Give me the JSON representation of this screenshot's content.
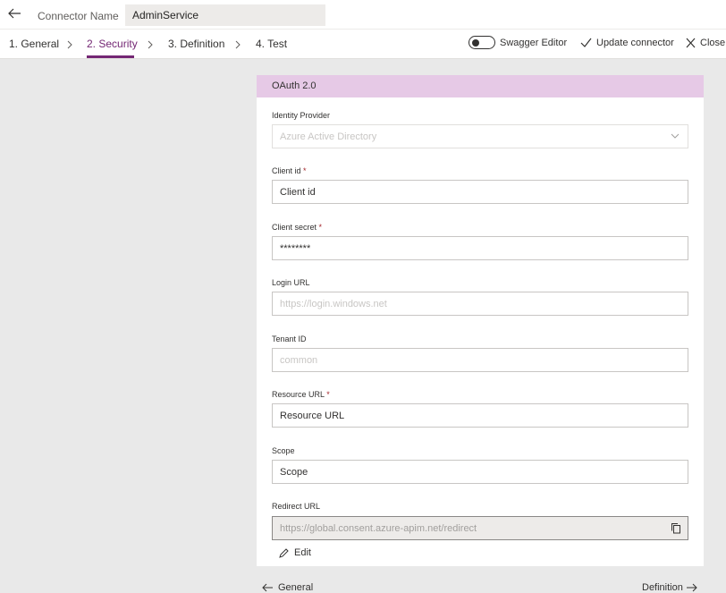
{
  "header": {
    "connector_label": "Connector Name",
    "connector_value": "AdminService"
  },
  "tabs": [
    {
      "label": "1. General"
    },
    {
      "label": "2. Security"
    },
    {
      "label": "3. Definition"
    },
    {
      "label": "4. Test"
    }
  ],
  "commands": {
    "swagger_label": "Swagger Editor",
    "update_label": "Update connector",
    "close_label": "Close"
  },
  "panel": {
    "title": "OAuth 2.0",
    "identity_provider": {
      "label": "Identity Provider",
      "value": "Azure Active Directory"
    },
    "client_id": {
      "label": "Client id",
      "required": "*",
      "value": "Client id"
    },
    "client_secret": {
      "label": "Client secret",
      "required": "*",
      "value": "********"
    },
    "login_url": {
      "label": "Login URL",
      "value": "https://login.windows.net"
    },
    "tenant_id": {
      "label": "Tenant ID",
      "value": "common"
    },
    "resource_url": {
      "label": "Resource URL",
      "required": "*",
      "value": "Resource URL"
    },
    "scope": {
      "label": "Scope",
      "value": "Scope"
    },
    "redirect_url": {
      "label": "Redirect URL",
      "value": "https://global.consent.azure-apim.net/redirect"
    },
    "edit_label": "Edit"
  },
  "footer": {
    "prev_label": "General",
    "next_label": "Definition"
  },
  "colors": {
    "accent": "#742774",
    "panel_header": "#e6c9e6",
    "background": "#e9e9e9"
  }
}
